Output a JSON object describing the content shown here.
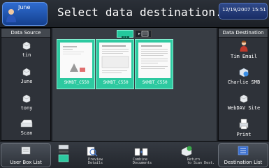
{
  "header": {
    "user_name": "June",
    "title": "Select data destination.",
    "datetime": "12/19/2007 15:51"
  },
  "left_panel": {
    "title": "Data Source",
    "items": [
      {
        "label": "tin",
        "icon": "user-box-icon"
      },
      {
        "label": "June",
        "icon": "user-box-icon"
      },
      {
        "label": "tony",
        "icon": "user-box-icon"
      },
      {
        "label": "Scan",
        "icon": "scanner-icon"
      }
    ]
  },
  "right_panel": {
    "title": "Data Destination",
    "items": [
      {
        "label": "Tim Email",
        "icon": "person-icon"
      },
      {
        "label": "Charlie SMB",
        "icon": "network-folder-icon"
      },
      {
        "label": "WebDAV Site",
        "icon": "webdav-icon"
      },
      {
        "label": "Print",
        "icon": "printer-icon"
      }
    ]
  },
  "center": {
    "documents": [
      {
        "label": "SKMBT_C550"
      },
      {
        "label": "SKMBT_C550"
      },
      {
        "label": "SKMBT_C550"
      }
    ]
  },
  "bottom_bar": {
    "user_box_list": "User Box List",
    "preview_details": "Preview Details",
    "combine_documents": "Combine Documents",
    "return_to_scan_dest": "Return to Scan Dest.",
    "destination_list": "Destination List"
  },
  "colors": {
    "accent_teal": "#2dc9a0",
    "user_blue": "#2f6cd0"
  }
}
